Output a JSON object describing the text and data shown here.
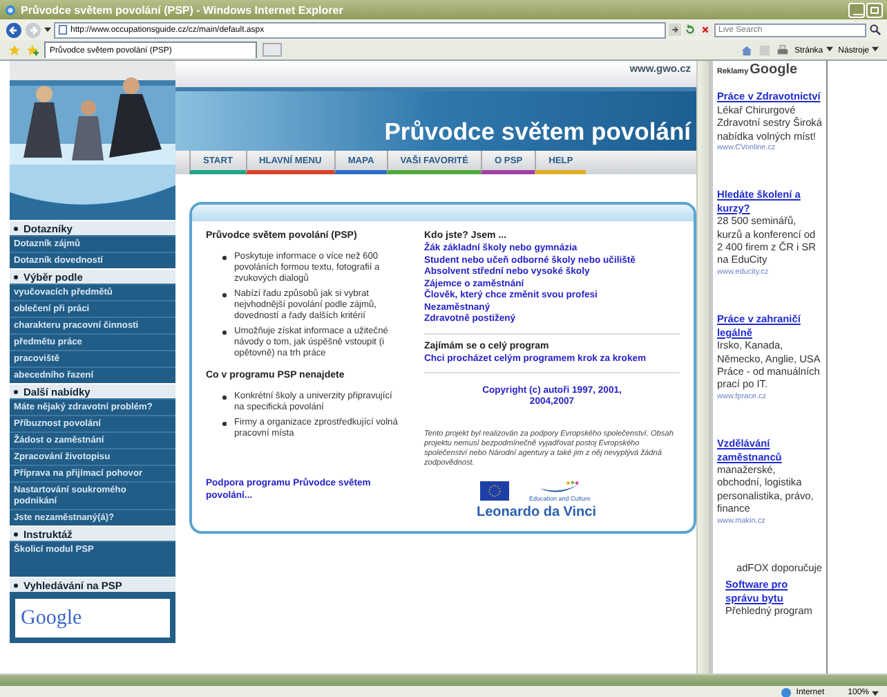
{
  "window": {
    "title": "Průvodce světem povolání (PSP) - Windows Internet Explorer"
  },
  "address_bar": {
    "url": "http://www.occupationsguide.cz/cz/main/default.aspx",
    "search_placeholder": "Live Search"
  },
  "tabs": [
    {
      "label": "Průvodce světem povolání (PSP)",
      "selected": true
    }
  ],
  "toolbar": {
    "menus": [
      "Stránka",
      "Nástroje"
    ]
  },
  "site": {
    "domain": "www.gwo.cz",
    "title": "Průvodce světem povolání",
    "nav": [
      {
        "label": "START",
        "color": "#22a58a"
      },
      {
        "label": "HLAVNÍ MENU",
        "color": "#d8432a"
      },
      {
        "label": "MAPA",
        "color": "#2a6fc4"
      },
      {
        "label": "VAŠI FAVORITÉ",
        "color": "#4caa3a"
      },
      {
        "label": "O PSP",
        "color": "#a43ea8"
      },
      {
        "label": "HELP",
        "color": "#e0b020"
      }
    ]
  },
  "sidebar": [
    {
      "kind": "links",
      "heading": "Dotazníky",
      "items": [
        "Dotazník zájmů",
        "Dotazník dovedností"
      ]
    },
    {
      "kind": "links",
      "heading": "Výběr podle",
      "items": [
        "vyučovacích předmětů",
        "oblečení při práci",
        "charakteru pracovní činnosti",
        "předmětu práce",
        "pracoviště",
        "abecedního řazení"
      ]
    },
    {
      "kind": "links",
      "heading": "Další nabídky",
      "items": [
        "Máte nějaký zdravotní problém?",
        "Příbuznost povolání",
        "Žádost o zaměstnání",
        "Zpracování životopisu",
        "Příprava na přijímací pohovor",
        "Nastartování soukromého podnikání",
        "Jste nezaměstnaný(á)?"
      ]
    },
    {
      "kind": "links",
      "heading": "Instruktáž",
      "items": [
        "Školicí modul PSP"
      ]
    },
    {
      "kind": "search",
      "heading": "Vyhledávání na PSP",
      "logo": "Google"
    }
  ],
  "about": {
    "heading": "Průvodce světem povolání (PSP)",
    "points": [
      "Poskytuje informace o více než 600 povoláních formou textu, fotografií a zvukových dialogů",
      "Nabízí řadu způsobů jak si vybrat nejvhodnější povolání podle zájmů, dovedností a řady dalších kritérií",
      "Umožňuje získat informace a užitečné návody o tom, jak úspěšně vstoupit (i opětovně) na trh práce"
    ],
    "missing_heading": "Co v programu PSP nenajdete",
    "missing_points": [
      "Konkrétní školy a univerzity připravující na specifická povolání",
      "Firmy a organizace zprostředkující volná pracovní místa"
    ],
    "support_link": "Podpora programu Průvodce světem povolání..."
  },
  "who": {
    "heading": "Kdo jste? Jsem ...",
    "links": [
      "Žák základní školy nebo gymnázia",
      "Student nebo učeň odborné školy nebo učiliště",
      "Absolvent střední nebo vysoké školy",
      "Zájemce o zaměstnání",
      "Člověk, který chce změnit svou profesi",
      "Nezaměstnaný",
      "Zdravotně postižený"
    ],
    "program_heading": "Zajímám se o celý program",
    "program_link": "Chci procházet celým programem krok za krokem",
    "copyright": "Copyright (c) autoři 1997, 2001, 2004,2007",
    "disclaimer": "Tento projekt byl realizován za podpory Evropského společenství. Obsah projektu nemusí bezpodmínečně vyjadřovat postoj Evropského společenství nebo Národní agentury a také jim z něj nevyplývá žádná zodpovědnost.",
    "logo_caption": "Education and Culture",
    "programme": "Leonardo da Vinci"
  },
  "ads": {
    "label": "Reklamy",
    "brand": "Google",
    "items": [
      {
        "title": "Práce v Zdravotnictví",
        "text": "Lékař Chirurgové Zdravotní sestry Široká nabídka volných míst!",
        "url": "www.CVonline.cz"
      },
      {
        "title": "Hledáte školení a kurzy?",
        "text": "28 500 seminářů, kurzů a konferencí od 2 400 firem z ČR i SR na EduCity",
        "url": "www.educity.cz"
      },
      {
        "title": "Práce v zahraničí legálně",
        "text": "Irsko, Kanada, Německo, Anglie, USA Práce - od manuálních prací po IT.",
        "url": "www.fprace.cz"
      },
      {
        "title": "Vzdělávání zaměstnanců",
        "text": "manažerské, obchodní, logistika personalistika, právo, finance",
        "url": "www.makin.cz"
      }
    ],
    "sponsor": "adFOX doporučuje",
    "sponsored": {
      "title": "Software pro správu bytu",
      "text": "Přehledný program"
    }
  },
  "status_bar": {
    "zone": "Internet",
    "zoom": "100%"
  }
}
